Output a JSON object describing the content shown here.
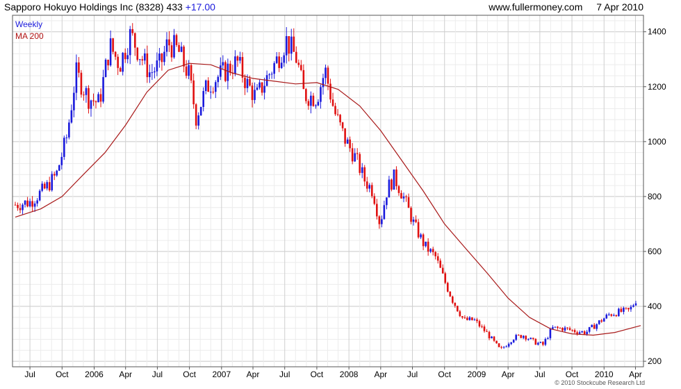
{
  "header": {
    "security": "Sapporo Hokuyo Holdings Inc (8328) 433",
    "change": "+17.00",
    "site": "www.fullermoney.com",
    "date": "7 Apr 2010"
  },
  "legend": {
    "series1": "Weekly",
    "series2": "MA 200"
  },
  "copyright": "© 2010 Stockcube Research Ltd",
  "colors": {
    "up": "#1a1adc",
    "down": "#e01010",
    "ma": "#a81818",
    "grid": "#d8d8d8"
  },
  "chart_data": {
    "type": "line",
    "title": "Sapporo Hokuyo Holdings Inc (8328)",
    "frequency": "Weekly",
    "y_axis": {
      "side": "right",
      "ylim": [
        180,
        1460
      ],
      "ticks": [
        200,
        400,
        600,
        800,
        1000,
        1200,
        1400
      ]
    },
    "x_axis": {
      "range": [
        "2005-05-20",
        "2010-04-16"
      ],
      "ticks": [
        {
          "label": "Jul",
          "date": "2005-07-01"
        },
        {
          "label": "Oct",
          "date": "2005-10-01"
        },
        {
          "label": "2006",
          "date": "2006-01-01"
        },
        {
          "label": "Apr",
          "date": "2006-04-01"
        },
        {
          "label": "Jul",
          "date": "2006-07-01"
        },
        {
          "label": "Oct",
          "date": "2006-10-01"
        },
        {
          "label": "2007",
          "date": "2007-01-01"
        },
        {
          "label": "Apr",
          "date": "2007-04-01"
        },
        {
          "label": "Jul",
          "date": "2007-07-01"
        },
        {
          "label": "Oct",
          "date": "2007-10-01"
        },
        {
          "label": "2008",
          "date": "2008-01-01"
        },
        {
          "label": "Apr",
          "date": "2008-04-01"
        },
        {
          "label": "Jul",
          "date": "2008-07-01"
        },
        {
          "label": "Oct",
          "date": "2008-10-01"
        },
        {
          "label": "2009",
          "date": "2009-01-01"
        },
        {
          "label": "Apr",
          "date": "2009-04-01"
        },
        {
          "label": "Jul",
          "date": "2009-07-01"
        },
        {
          "label": "Oct",
          "date": "2009-10-01"
        },
        {
          "label": "2010",
          "date": "2010-01-01"
        },
        {
          "label": "Apr",
          "date": "2010-04-01"
        }
      ]
    },
    "grid": true,
    "legend_position": "top-left",
    "series": [
      {
        "name": "Weekly",
        "style": "candlestick",
        "points": [
          [
            "2005-05-20",
            770
          ],
          [
            "2005-07-01",
            780
          ],
          [
            "2005-08-15",
            830
          ],
          [
            "2005-09-15",
            880
          ],
          [
            "2005-10-15",
            1020
          ],
          [
            "2005-11-10",
            1250
          ],
          [
            "2005-12-15",
            1160
          ],
          [
            "2006-01-15",
            1140
          ],
          [
            "2006-02-15",
            1350
          ],
          [
            "2006-03-15",
            1280
          ],
          [
            "2006-04-15",
            1390
          ],
          [
            "2006-05-15",
            1310
          ],
          [
            "2006-06-10",
            1250
          ],
          [
            "2006-07-10",
            1280
          ],
          [
            "2006-07-31",
            1360
          ],
          [
            "2006-08-30",
            1330
          ],
          [
            "2006-09-30",
            1240
          ],
          [
            "2006-10-20",
            1090
          ],
          [
            "2006-11-20",
            1200
          ],
          [
            "2006-12-15",
            1230
          ],
          [
            "2007-01-15",
            1260
          ],
          [
            "2007-02-15",
            1290
          ],
          [
            "2007-03-15",
            1210
          ],
          [
            "2007-04-10",
            1160
          ],
          [
            "2007-05-10",
            1230
          ],
          [
            "2007-06-10",
            1300
          ],
          [
            "2007-07-05",
            1370
          ],
          [
            "2007-08-05",
            1300
          ],
          [
            "2007-08-25",
            1170
          ],
          [
            "2007-10-01",
            1160
          ],
          [
            "2007-10-25",
            1260
          ],
          [
            "2007-11-20",
            1110
          ],
          [
            "2007-12-20",
            1010
          ],
          [
            "2008-01-20",
            940
          ],
          [
            "2008-02-15",
            860
          ],
          [
            "2008-03-10",
            820
          ],
          [
            "2008-03-30",
            700
          ],
          [
            "2008-04-20",
            830
          ],
          [
            "2008-05-10",
            870
          ],
          [
            "2008-06-05",
            800
          ],
          [
            "2008-07-05",
            700
          ],
          [
            "2008-08-05",
            620
          ],
          [
            "2008-09-05",
            580
          ],
          [
            "2008-10-05",
            480
          ],
          [
            "2008-10-25",
            420
          ],
          [
            "2008-11-25",
            350
          ],
          [
            "2008-12-25",
            350
          ],
          [
            "2009-02-01",
            300
          ],
          [
            "2009-03-10",
            240
          ],
          [
            "2009-04-15",
            285
          ],
          [
            "2009-05-15",
            295
          ],
          [
            "2009-06-15",
            270
          ],
          [
            "2009-07-10",
            260
          ],
          [
            "2009-08-05",
            320
          ],
          [
            "2009-09-05",
            320
          ],
          [
            "2009-10-10",
            310
          ],
          [
            "2009-11-10",
            305
          ],
          [
            "2009-12-15",
            340
          ],
          [
            "2010-01-15",
            370
          ],
          [
            "2010-02-15",
            380
          ],
          [
            "2010-03-15",
            385
          ],
          [
            "2010-04-07",
            433
          ]
        ]
      },
      {
        "name": "MA 200",
        "style": "line",
        "points": [
          [
            "2005-05-20",
            725
          ],
          [
            "2005-08-01",
            755
          ],
          [
            "2005-10-01",
            800
          ],
          [
            "2005-12-01",
            880
          ],
          [
            "2006-02-01",
            960
          ],
          [
            "2006-04-01",
            1060
          ],
          [
            "2006-06-01",
            1180
          ],
          [
            "2006-08-01",
            1260
          ],
          [
            "2006-10-01",
            1285
          ],
          [
            "2006-12-01",
            1280
          ],
          [
            "2007-02-01",
            1250
          ],
          [
            "2007-04-01",
            1230
          ],
          [
            "2007-06-01",
            1220
          ],
          [
            "2007-08-01",
            1210
          ],
          [
            "2007-10-01",
            1215
          ],
          [
            "2007-12-01",
            1190
          ],
          [
            "2008-02-01",
            1130
          ],
          [
            "2008-04-01",
            1040
          ],
          [
            "2008-06-01",
            930
          ],
          [
            "2008-08-01",
            820
          ],
          [
            "2008-10-01",
            700
          ],
          [
            "2008-12-01",
            610
          ],
          [
            "2009-02-01",
            520
          ],
          [
            "2009-04-01",
            430
          ],
          [
            "2009-06-01",
            360
          ],
          [
            "2009-08-01",
            318
          ],
          [
            "2009-10-01",
            300
          ],
          [
            "2009-12-01",
            295
          ],
          [
            "2010-02-01",
            305
          ],
          [
            "2010-04-16",
            330
          ]
        ]
      }
    ]
  }
}
